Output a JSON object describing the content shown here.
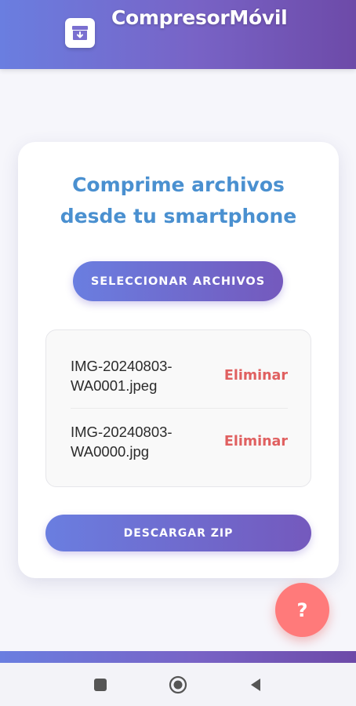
{
  "header": {
    "title": "CompresorMóvil",
    "logo_icon": "archive-download-icon",
    "colors": {
      "gradient_start": "#6a7ee0",
      "gradient_end": "#6d4aa8"
    }
  },
  "card": {
    "headline_line1": "Comprime archivos",
    "headline_line2": "desde tu smartphone",
    "select_button_label": "SELECCIONAR ARCHIVOS",
    "files": [
      {
        "name_line1": "IMG-20240803-",
        "name_line2": "WA0001.jpeg",
        "delete_label": "Eliminar"
      },
      {
        "name_line1": "IMG-20240803-",
        "name_line2": "WA0000.jpg",
        "delete_label": "Eliminar"
      }
    ],
    "download_button_label": "DESCARGAR ZIP"
  },
  "help_button": {
    "label": "?",
    "color": "#ff7a7a"
  },
  "accent_colors": {
    "headline": "#4a90d0",
    "delete": "#e06060"
  },
  "system_nav": {
    "buttons": [
      "recent-apps-icon",
      "home-icon",
      "back-icon"
    ]
  }
}
